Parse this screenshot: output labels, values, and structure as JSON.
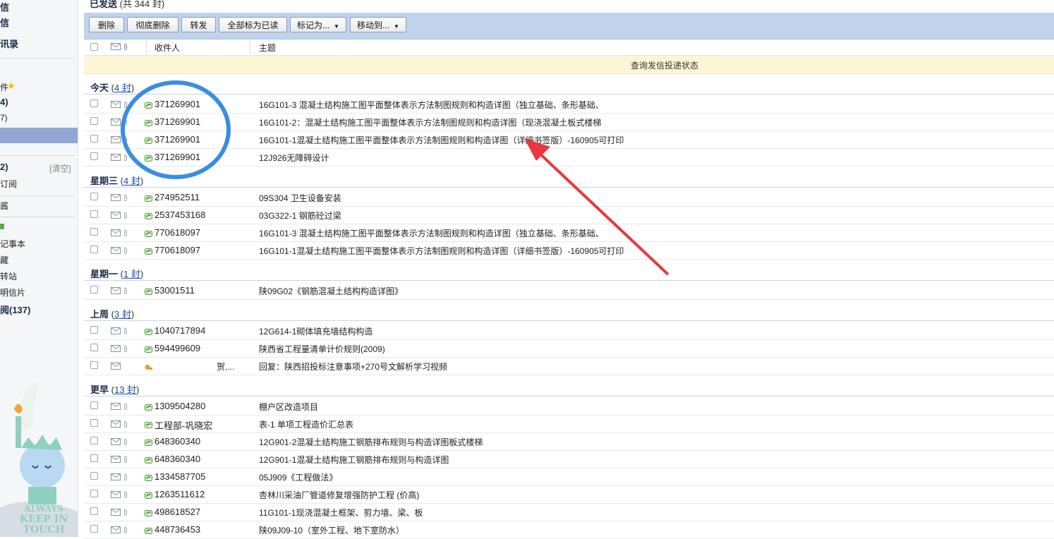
{
  "sidebar": {
    "items": [
      {
        "label": "信",
        "bold": true
      },
      {
        "label": "信",
        "bold": true
      },
      {
        "label": "讯录",
        "bold": true
      },
      {
        "label": "件",
        "bold": false
      },
      {
        "label": "4)",
        "bold": true
      },
      {
        "label": "7)",
        "bold": false
      },
      {
        "label": "2)",
        "bold": true
      },
      {
        "label": "订阅",
        "bold": false
      },
      {
        "label": "酱",
        "bold": false
      },
      {
        "label": "",
        "bold": false
      },
      {
        "label": "记事本",
        "bold": false
      },
      {
        "label": "藏",
        "bold": false
      },
      {
        "label": "转站",
        "bold": false
      },
      {
        "label": "明信片",
        "bold": false
      },
      {
        "label": "阅(137)",
        "bold": true
      }
    ],
    "clear_label": "[清空]",
    "mascot_text": [
      "ALWAYS",
      "KEEP IN",
      "TOUCH"
    ]
  },
  "folder": {
    "title": "已发送",
    "count_text": "(共 344 封)"
  },
  "toolbar": {
    "buttons": [
      "删除",
      "彻底删除",
      "转发",
      "全部标为已读",
      "标记为...",
      "移动到..."
    ]
  },
  "columns": {
    "recipient": "收件人",
    "subject": "主题"
  },
  "notice": "查询发信投递状态",
  "groups": [
    {
      "label": "今天",
      "count": "4 封",
      "rows": [
        {
          "recipient": "371269901",
          "subject": "16G101-3 混凝土结构施工图平面整体表示方法制图规则和构造详图（独立基础、条形基础、"
        },
        {
          "recipient": "371269901",
          "subject": "16G101-2：混凝土结构施工图平面整体表示方法制图规则和构造详图（现浇混凝土板式楼梯"
        },
        {
          "recipient": "371269901",
          "subject": "16G101-1混凝土结构施工图平面整体表示方法制图规则和构造详图（详细书签版）-160905可打印"
        },
        {
          "recipient": "371269901",
          "subject": "12J926无障碍设计"
        }
      ]
    },
    {
      "label": "星期三",
      "count": "4 封",
      "rows": [
        {
          "recipient": "274952511",
          "subject": "09S304 卫生设备安装"
        },
        {
          "recipient": "2537453168",
          "subject": "03G322-1 钢筋砼过梁"
        },
        {
          "recipient": "770618097",
          "subject": "16G101-3 混凝土结构施工图平面整体表示方法制图规则和构造详图（独立基础、条形基础、"
        },
        {
          "recipient": "770618097",
          "subject": "16G101-1混凝土结构施工图平面整体表示方法制图规则和构造详图（详细书签版）-160905可打印"
        }
      ]
    },
    {
      "label": "星期一",
      "count": "1 封",
      "rows": [
        {
          "recipient": "53001511",
          "subject": "陕09G02《钢筋混凝土结构构造详图》"
        }
      ]
    },
    {
      "label": "上周",
      "count": "3 封",
      "rows": [
        {
          "recipient": "1040717894",
          "subject": "12G614-1砌体填充墙结构构造"
        },
        {
          "recipient": "594499609",
          "subject": "陕西省工程量清单计价规则(2009)"
        },
        {
          "recipient": "贺,...",
          "subject": "回复：陕西招投标注意事项+270号文解析学习视频",
          "reply": true
        }
      ]
    },
    {
      "label": "更早",
      "count": "13 封",
      "rows": [
        {
          "recipient": "1309504280",
          "subject": "棚户区改造项目"
        },
        {
          "recipient": "工程部-巩晓宏",
          "subject": "表-1 单项工程造价汇总表"
        },
        {
          "recipient": "648360340",
          "subject": "12G901-2混凝土结构施工钢筋排布规则与构造详图板式楼梯"
        },
        {
          "recipient": "648360340",
          "subject": "12G901-1混凝土结构施工钢筋排布规则与构造详图"
        },
        {
          "recipient": "1334587705",
          "subject": "05J909《工程做法》"
        },
        {
          "recipient": "1263511612",
          "subject": "杏林川采油厂管道修复增强防护工程 (价高)"
        },
        {
          "recipient": "498618527",
          "subject": "11G101-1现浇混凝土框架、剪力墙、梁、板"
        },
        {
          "recipient": "448736453",
          "subject": "陕09J09-10（室外工程、地下室防水）"
        }
      ]
    }
  ],
  "annotation": {
    "circle_color": "#3a8ee0",
    "arrow_color": "#e8383d"
  }
}
